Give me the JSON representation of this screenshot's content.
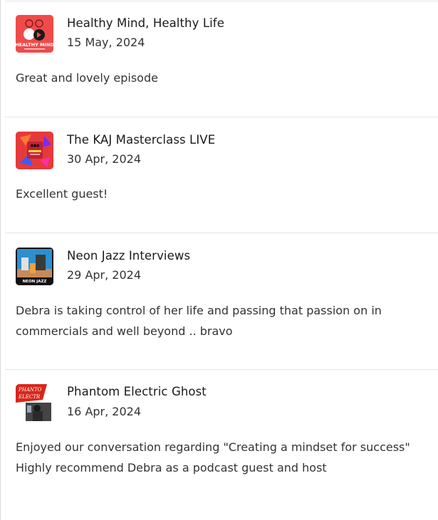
{
  "reviews": [
    {
      "podcast": "Healthy Mind, Healthy Life",
      "date": "15 May, 2024",
      "comment_lines": [
        "Great and lovely episode"
      ],
      "thumb_icon": "healthy-mind-logo",
      "thumb_text": "HEALTHY MIND",
      "colors": {
        "bg": "#ef4b4b"
      }
    },
    {
      "podcast": "The KAJ Masterclass LIVE",
      "date": "30 Apr, 2024",
      "comment_lines": [
        "Excellent guest!"
      ],
      "thumb_icon": "kaj-masterclass-logo",
      "colors": {
        "bg": "#e63a3a"
      }
    },
    {
      "podcast": "Neon Jazz Interviews",
      "date": "29 Apr, 2024",
      "comment_lines": [
        "Debra is taking control of her life and passing that passion on in",
        "commercials and well beyond .. bravo"
      ],
      "thumb_icon": "neon-jazz-logo",
      "thumb_text": "NEON JAZZ",
      "colors": {
        "bg": "#1b2b3a"
      }
    },
    {
      "podcast": "Phantom Electric Ghost",
      "date": "16 Apr, 2024",
      "comment_lines": [
        "Enjoyed our conversation regarding \"Creating a mindset for success\"",
        "Highly recommend Debra as a podcast guest and host"
      ],
      "thumb_icon": "phantom-electric-logo",
      "thumb_text": "PHANTO ELECTR",
      "colors": {
        "bg": "#d9261c"
      }
    }
  ]
}
